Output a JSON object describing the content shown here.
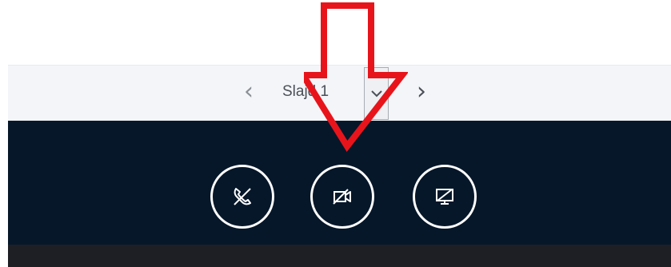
{
  "slide_nav": {
    "prev_symbol": "‹",
    "current_slide": "Slajd 1",
    "next_symbol": "›",
    "dropdown_icon": "chevron-down-icon"
  },
  "controls": {
    "audio_icon": "phone-off-icon",
    "video_icon": "video-off-icon",
    "screen_icon": "screen-share-off-icon"
  },
  "annotation": {
    "arrow_color": "#e8141b"
  },
  "colors": {
    "slide_bar_bg": "#f3f5f8",
    "control_bar_bg": "#06172a",
    "bottom_strip_bg": "#1e1f24",
    "icon_color": "#ffffff"
  }
}
